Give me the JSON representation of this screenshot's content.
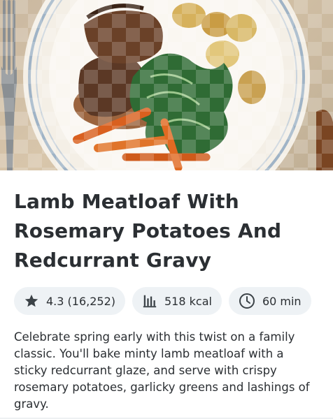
{
  "recipe": {
    "title": "Lamb Meatloaf With Rosemary Potatoes And Redcurrant Gravy",
    "hero_image": "Plate of lamb meatloaf with gravy, roasted potatoes, greens and carrots"
  },
  "stats": {
    "rating": "4.3 (16,252)",
    "calories": "518 kcal",
    "time": "60 min"
  },
  "icons": {
    "rating": "star-icon",
    "calories": "bar-chart-icon",
    "time": "clock-icon"
  },
  "description": "Celebrate spring early with this twist on a family classic. You'll bake minty lamb meatloaf with a sticky redcurrant glaze, and serve with crispy rosemary potatoes, garlicky greens and lashings of gravy."
}
